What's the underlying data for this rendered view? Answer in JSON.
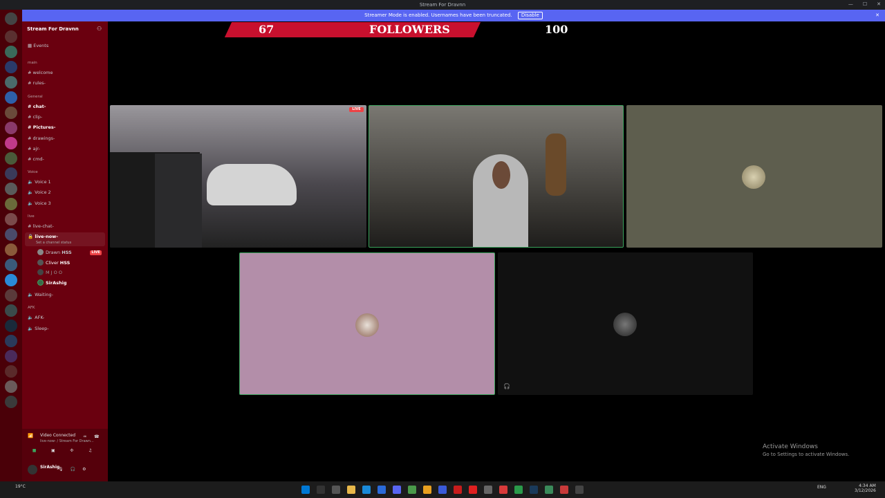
{
  "window": {
    "title": "Stream For Dravnn"
  },
  "banner": {
    "text": "Streamer Mode is enabled. Usernames have been truncated.",
    "disable_label": "Disable"
  },
  "server": {
    "name": "Stream For Dravnn"
  },
  "sidebar": {
    "events": "Events",
    "categories": {
      "main": "main",
      "general": "General",
      "voice": "Voice",
      "live": "live",
      "afk": "AFK"
    },
    "channels": {
      "welcome": "welcome",
      "rules": "rules-",
      "chat": "chat-",
      "clip": "clip-",
      "pictures": "Pictures-",
      "drawings": "drawings-",
      "ajr": "ajr-",
      "cmd": "cmd-",
      "voice1": "Voice 1",
      "voice2": "Voice 2",
      "voice3": "Voice 3",
      "live_chat": "live-chat-",
      "live_now": "live-now-",
      "live_now_status": "Set a channel status",
      "waiting": "Waiting-",
      "afk": "AFK-",
      "sleep": "Sleep-"
    },
    "voice_users": [
      {
        "name": "Drawn",
        "tag": "HSS",
        "live": "LIVE"
      },
      {
        "name": "Cliver",
        "tag": "HSS"
      },
      {
        "name": "M J O O"
      },
      {
        "name": "SirAshig"
      }
    ]
  },
  "user_panel": {
    "status": "Video Connected",
    "location": "live-now- / Stream For Drawn...",
    "username": "SirAshig"
  },
  "overlay": {
    "followers_count": "67",
    "followers_label": "FOLLOWERS",
    "followers_goal": "100"
  },
  "activate": {
    "line1": "Activate Windows",
    "line2": "Go to Settings to activate Windows."
  },
  "taskbar": {
    "weather": "19°C",
    "lang": "ENG",
    "time": "4:34 AM",
    "date": "3/12/2026"
  },
  "colors": {
    "accent": "#5865f2",
    "live": "#ed4245",
    "ticker": "#c8102e",
    "speaking": "#3ba55d"
  }
}
